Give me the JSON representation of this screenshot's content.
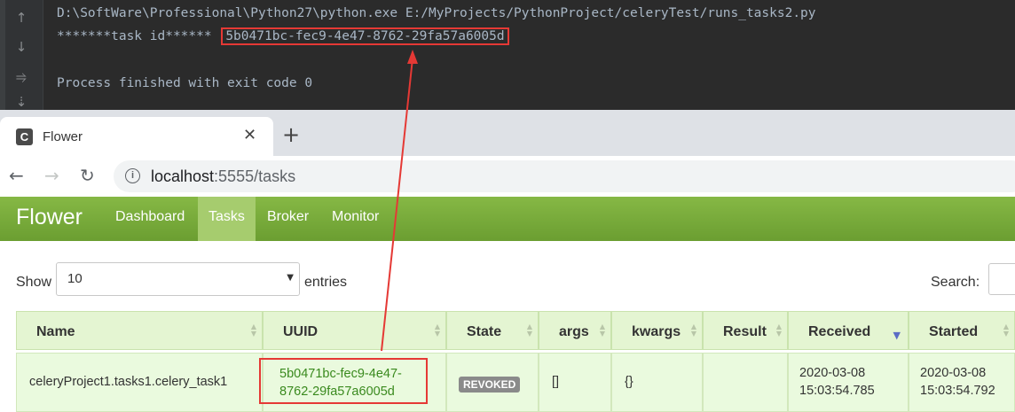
{
  "console": {
    "command": "D:\\SoftWare\\Professional\\Python27\\python.exe E:/MyProjects/PythonProject/celeryTest/runs_tasks2.py",
    "task_prefix": "*******task id****** ",
    "task_id": "5b0471bc-fec9-4e47-8762-29fa57a6005d",
    "exit_message": "Process finished with exit code 0"
  },
  "browser": {
    "tab_title": "Flower",
    "favicon_letter": "C",
    "url_host": "localhost",
    "url_rest": ":5555/tasks"
  },
  "flower": {
    "brand": "Flower",
    "nav": [
      "Dashboard",
      "Tasks",
      "Broker",
      "Monitor"
    ],
    "active_nav": "Tasks"
  },
  "table_controls": {
    "show_label": "Show",
    "entries_per_page": "10",
    "entries_label": "entries",
    "search_label": "Search:"
  },
  "table": {
    "columns": [
      "Name",
      "UUID",
      "State",
      "args",
      "kwargs",
      "Result",
      "Received",
      "Started"
    ],
    "sorted_column": "Received",
    "rows": [
      {
        "name": "celeryProject1.tasks1.celery_task1",
        "uuid_line1": "5b0471bc-fec9-4e47-",
        "uuid_line2": "8762-29fa57a6005d",
        "state": "REVOKED",
        "args": "[]",
        "kwargs": "{}",
        "result": "",
        "received_date": "2020-03-08",
        "received_time": "15:03:54.785",
        "started_date": "2020-03-08",
        "started_time": "15:03:54.792"
      }
    ]
  },
  "colors": {
    "highlight": "#e53935",
    "navbar": "#7aaa3c",
    "uuid_link": "#3a8a1e"
  }
}
